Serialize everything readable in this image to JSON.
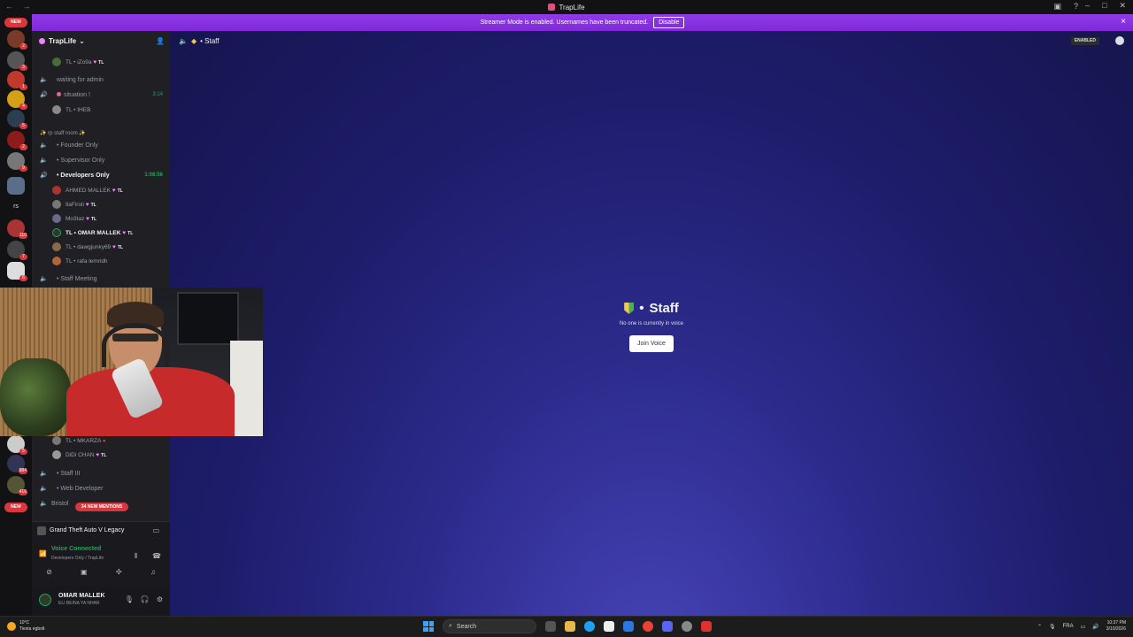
{
  "window": {
    "title": "TrapLife"
  },
  "streamer_banner": {
    "text": "Streamer Mode is enabled. Usernames have been truncated.",
    "button": "Disable",
    "close": "×"
  },
  "servers": {
    "new_top": "NEW",
    "new_bottom": "NEW",
    "rs_label": "rs",
    "badges": [
      "2",
      "3",
      "1",
      "4",
      "5",
      "2",
      "9",
      "8",
      "110",
      "7",
      "6",
      "5",
      "884",
      "416",
      "15"
    ]
  },
  "guild": {
    "name": "TrapLife"
  },
  "channels": {
    "rows": [
      {
        "type": "user",
        "text": "TL • iZo9a",
        "tag": "TL"
      },
      {
        "type": "voice",
        "text": "waiting for admin"
      },
      {
        "type": "voice-active",
        "text": "situation !",
        "timer": "3:14"
      },
      {
        "type": "user",
        "text": "TL • IHEB",
        "tag": ""
      },
      {
        "type": "category",
        "text": "✨ rp staff room ✨"
      },
      {
        "type": "voice",
        "text": "• Founder Only"
      },
      {
        "type": "voice",
        "text": "• Supervisor Only"
      },
      {
        "type": "voice-active",
        "text": "• Developers Only",
        "timer": "1:08:56"
      },
      {
        "type": "user",
        "text": "AHMED MALLEK",
        "tag": "TL"
      },
      {
        "type": "user",
        "text": "IlaFiroli",
        "tag": "TL"
      },
      {
        "type": "user",
        "text": "Mo3taz",
        "tag": "TL"
      },
      {
        "type": "user",
        "text": "TL • OMAR MALLEK",
        "tag": "TL"
      },
      {
        "type": "user",
        "text": "TL • dawgjunky69",
        "tag": "TL"
      },
      {
        "type": "user",
        "text": "TL • rafa lemridh",
        "tag": ""
      },
      {
        "type": "voice",
        "text": "• Staff Meeting"
      },
      {
        "type": "user",
        "text": "TL • MKARZA",
        "tag": ""
      },
      {
        "type": "user",
        "text": "DiDi CHAN",
        "tag": "TL"
      },
      {
        "type": "voice",
        "text": "• Staff III"
      },
      {
        "type": "voice",
        "text": "• Web Developer"
      },
      {
        "type": "voice",
        "text": "Bristol"
      }
    ],
    "mentions": "34 NEW MENTIONS"
  },
  "activity": {
    "game": "Grand Theft Auto V Legacy"
  },
  "voice": {
    "status": "Voice Connected",
    "channel": "Developers Only / TrapLife"
  },
  "user": {
    "name": "OMAR MALLEK",
    "status": "ELI BEINA YA NHAR"
  },
  "header": {
    "channel": "Staff",
    "enabled_badge": "ENABLED"
  },
  "center": {
    "title": "Staff",
    "subtitle": "No one is currently in voice",
    "join": "Join Voice"
  },
  "taskbar": {
    "weather_temp": "10°C",
    "weather_desc": "Tiesta ėgbolt",
    "search": "Search",
    "lang": "FRA",
    "time": "10:37 PM",
    "date": "3/10/2026"
  },
  "colors": {
    "banner": "#8129d9",
    "online": "#23a55a",
    "danger": "#da373c",
    "sidebar": "#1f1f24"
  }
}
